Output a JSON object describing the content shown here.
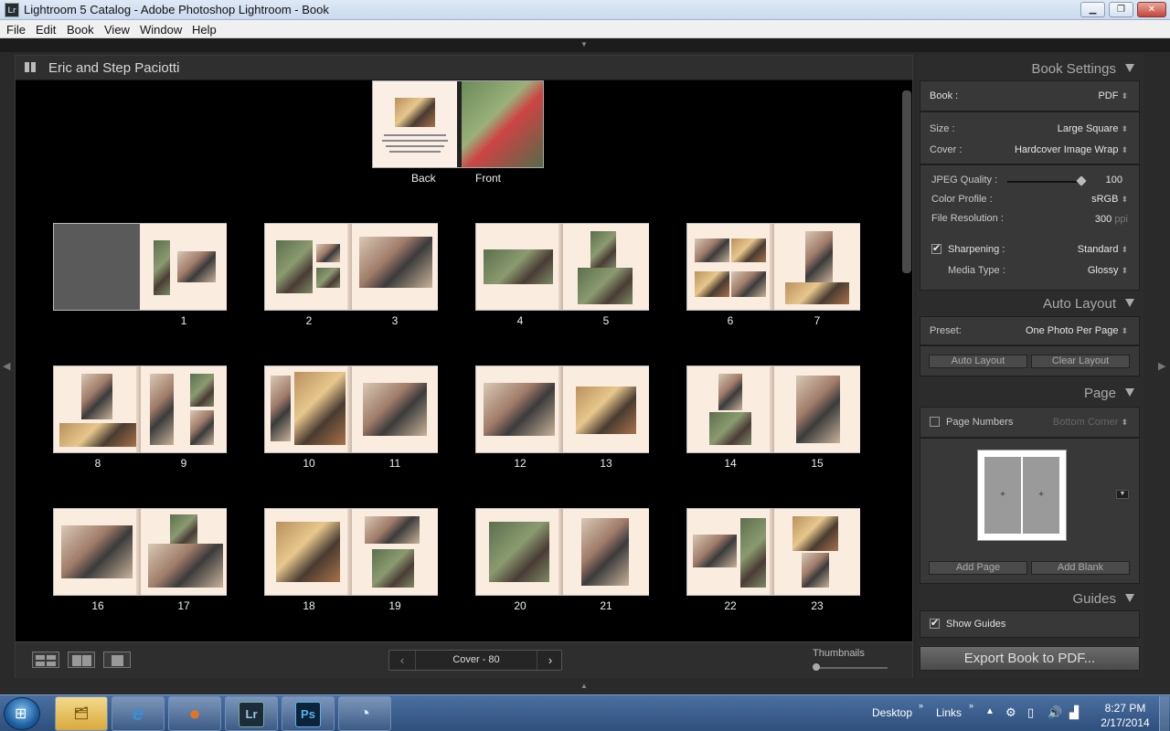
{
  "window": {
    "app_icon": "Lr",
    "title": "Lightroom 5 Catalog - Adobe Photoshop Lightroom - Book",
    "minimize": "▁",
    "maximize": "❐",
    "close": "✕"
  },
  "menubar": [
    "File",
    "Edit",
    "Book",
    "View",
    "Window",
    "Help"
  ],
  "center": {
    "book_title": "Eric and Step Paciotti",
    "cover_back_label": "Back",
    "cover_front_label": "Front",
    "spreads": [
      {
        "left": "",
        "right": "1"
      },
      {
        "left": "2",
        "right": "3"
      },
      {
        "left": "4",
        "right": "5"
      },
      {
        "left": "6",
        "right": "7"
      },
      {
        "left": "8",
        "right": "9"
      },
      {
        "left": "10",
        "right": "11"
      },
      {
        "left": "12",
        "right": "13"
      },
      {
        "left": "14",
        "right": "15"
      },
      {
        "left": "16",
        "right": "17"
      },
      {
        "left": "18",
        "right": "19"
      },
      {
        "left": "20",
        "right": "21"
      },
      {
        "left": "22",
        "right": "23"
      }
    ],
    "toolbar": {
      "pager_label": "Cover - 80",
      "prev_icon": "‹",
      "next_icon": "›",
      "thumbnails_label": "Thumbnails"
    }
  },
  "right_panel": {
    "book_settings": {
      "header": "Book Settings",
      "book_label": "Book :",
      "book_value": "PDF",
      "size_label": "Size :",
      "size_value": "Large Square",
      "cover_label": "Cover :",
      "cover_value": "Hardcover Image Wrap",
      "jpeg_quality_label": "JPEG Quality :",
      "jpeg_quality_value": "100",
      "color_profile_label": "Color Profile :",
      "color_profile_value": "sRGB",
      "file_resolution_label": "File Resolution :",
      "file_resolution_value": "300",
      "file_resolution_unit": "ppi",
      "sharpening_label": "Sharpening :",
      "sharpening_value": "Standard",
      "media_type_label": "Media Type :",
      "media_type_value": "Glossy"
    },
    "auto_layout": {
      "header": "Auto Layout",
      "preset_label": "Preset:",
      "preset_value": "One Photo Per Page",
      "auto_layout_button": "Auto Layout",
      "clear_layout_button": "Clear Layout"
    },
    "page": {
      "header": "Page",
      "page_numbers_label": "Page Numbers",
      "page_numbers_value": "Bottom Corner",
      "add_page_button": "Add Page",
      "add_blank_button": "Add Blank"
    },
    "guides": {
      "header": "Guides",
      "show_guides_label": "Show Guides"
    },
    "export_button": "Export Book to PDF..."
  },
  "taskbar": {
    "apps": [
      {
        "name": "folder",
        "label": "🗂",
        "color": "#e8c35a"
      },
      {
        "name": "ie",
        "label": "e",
        "color": "#3b8fd6"
      },
      {
        "name": "firefox",
        "label": "●",
        "color": "#e0752a"
      },
      {
        "name": "lightroom",
        "label": "Lr",
        "color": "#1e2b38"
      },
      {
        "name": "photoshop",
        "label": "Ps",
        "color": "#0e2238"
      },
      {
        "name": "other",
        "label": "◔",
        "color": "#3a78c0"
      }
    ],
    "desktop_label": "Desktop",
    "links_label": "Links",
    "time": "8:27 PM",
    "date": "2/17/2014"
  },
  "colors": {
    "panel_bg": "#2c2c2c",
    "page_paper": "#fbece0",
    "accent_text": "#e6e6e6"
  }
}
